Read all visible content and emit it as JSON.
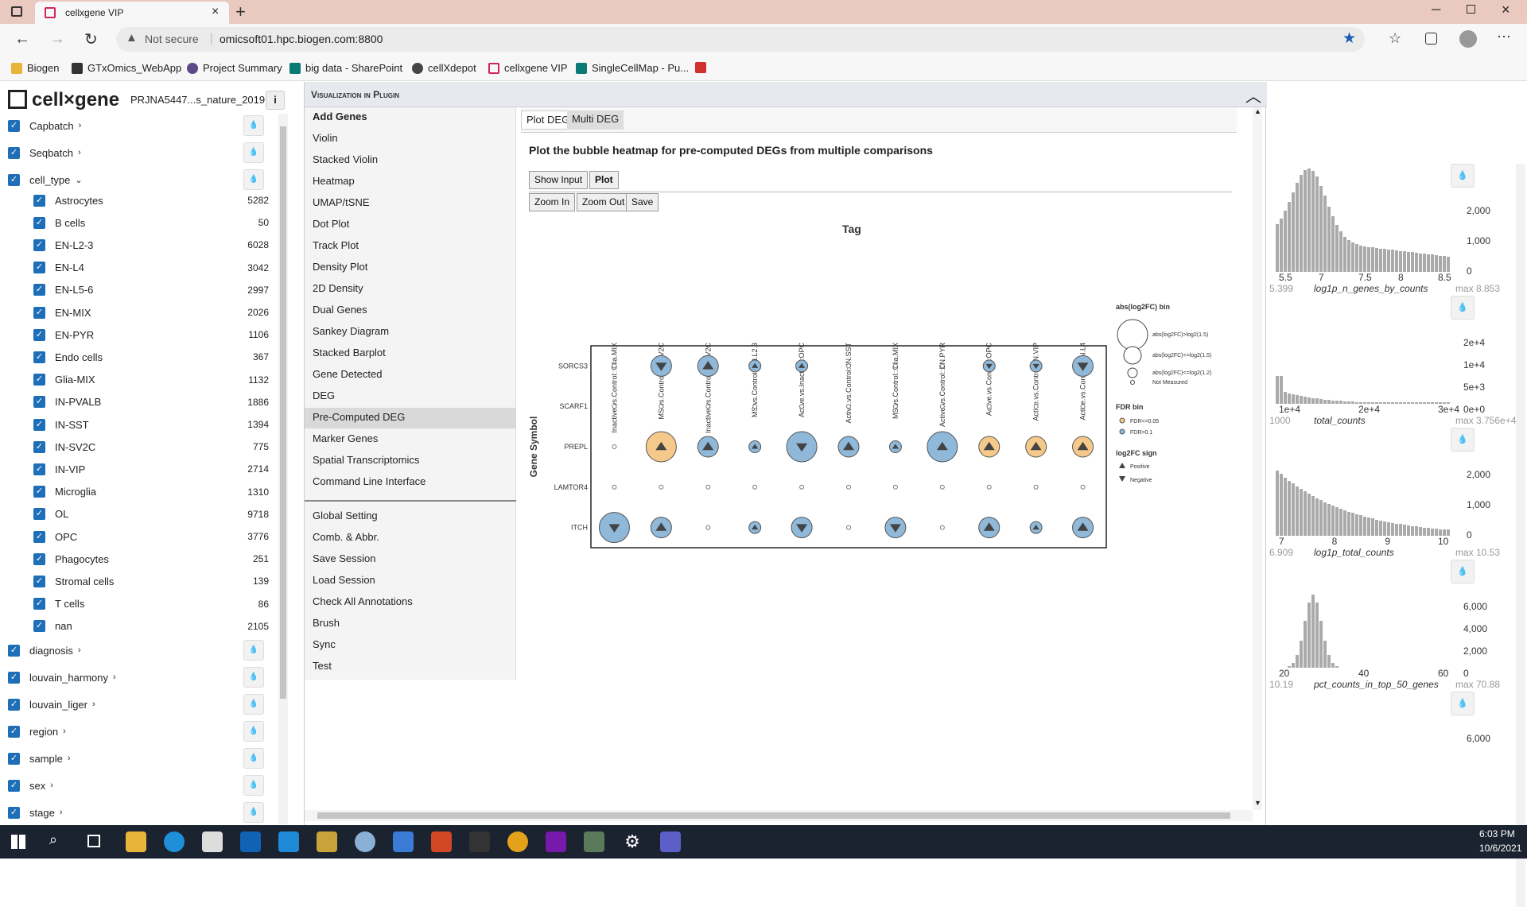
{
  "browser": {
    "tab_title": "cellxgene VIP",
    "security": "Not secure",
    "url": "omicsoft01.hpc.biogen.com:8800",
    "bookmarks": [
      "Biogen",
      "GTxOmics_WebApp",
      "Project Summary",
      "big data - SharePoint",
      "cellXdepot",
      "cellxgene VIP",
      "SingleCellMap - Pu..."
    ]
  },
  "app": {
    "logo": "cell×gene",
    "dataset": "PRJNA5447...s_nature_2019"
  },
  "sidebar": {
    "categories_top": [
      "Capbatch",
      "Seqbatch",
      "cell_type"
    ],
    "cell_types": [
      {
        "label": "Astrocytes",
        "count": "5282"
      },
      {
        "label": "B cells",
        "count": "50"
      },
      {
        "label": "EN-L2-3",
        "count": "6028"
      },
      {
        "label": "EN-L4",
        "count": "3042"
      },
      {
        "label": "EN-L5-6",
        "count": "2997"
      },
      {
        "label": "EN-MIX",
        "count": "2026"
      },
      {
        "label": "EN-PYR",
        "count": "1106"
      },
      {
        "label": "Endo cells",
        "count": "367"
      },
      {
        "label": "Glia-MIX",
        "count": "1132"
      },
      {
        "label": "IN-PVALB",
        "count": "1886"
      },
      {
        "label": "IN-SST",
        "count": "1394"
      },
      {
        "label": "IN-SV2C",
        "count": "775"
      },
      {
        "label": "IN-VIP",
        "count": "2714"
      },
      {
        "label": "Microglia",
        "count": "1310"
      },
      {
        "label": "OL",
        "count": "9718"
      },
      {
        "label": "OPC",
        "count": "3776"
      },
      {
        "label": "Phagocytes",
        "count": "251"
      },
      {
        "label": "Stromal cells",
        "count": "139"
      },
      {
        "label": "T cells",
        "count": "86"
      },
      {
        "label": "nan",
        "count": "2105"
      }
    ],
    "categories_bottom": [
      "diagnosis",
      "louvain_harmony",
      "louvain_liger",
      "region",
      "sample",
      "sex",
      "stage"
    ]
  },
  "plugin": {
    "title": "Visualization in Plugin",
    "menu": [
      "Add Genes",
      "Violin",
      "Stacked Violin",
      "Heatmap",
      "UMAP/tSNE",
      "Dot Plot",
      "Track Plot",
      "Density Plot",
      "2D Density",
      "Dual Genes",
      "Sankey Diagram",
      "Stacked Barplot",
      "Gene Detected",
      "DEG",
      "Pre-Computed DEG",
      "Marker Genes",
      "Spatial Transcriptomics",
      "Command Line Interface"
    ],
    "menu2": [
      "Global Setting",
      "Comb. & Abbr.",
      "Save Session",
      "Load Session",
      "Check All Annotations",
      "Brush",
      "Sync",
      "Test"
    ],
    "tabs": [
      "Plot DEG",
      "Multi DEG"
    ],
    "heading": "Plot the bubble heatmap for pre-computed DEGs from multiple comparisons",
    "buttons": {
      "show_input": "Show Input",
      "plot": "Plot",
      "zoom_in": "Zoom In",
      "zoom_out": "Zoom Out",
      "save": "Save"
    }
  },
  "chart_data": {
    "type": "bubble-heatmap",
    "title": "Tag",
    "ylabel": "Gene Symbol",
    "tags": [
      "Inactive.vs.Control::Glia.MIX",
      "MS.vs.Control::IN.SV2C",
      "Inactive.vs.Control::IN.SV2C",
      "MS.vs.Control::EN.L2.3",
      "Active.vs.Inactive::OPC",
      "Active.vs.Control::IN.SST",
      "MS.vs.Control::Glia.MIX",
      "Active.vs.Control::EN.PYR",
      "Active.vs.Control::OPC",
      "Active.vs.Control::IN.VIP",
      "Active.vs.Control::EN.L4"
    ],
    "genes": [
      "SORCS3",
      "SCARF1",
      "PREPL",
      "LAMTOR4",
      "ITCH"
    ],
    "size_levels": [
      "NM",
      "S",
      "M",
      "L"
    ],
    "cells": [
      [
        "NM",
        "M:blue:neg",
        "M:blue:pos",
        "S:blue:pos",
        "S:blue:pos",
        "NM",
        "NM",
        "NM",
        "S:blue:neg",
        "S:blue:neg",
        "M:blue:neg"
      ],
      [
        "NM",
        "NM",
        "NM",
        "NM",
        "NM",
        "NM",
        "NM",
        "NM",
        "NM",
        "NM",
        "NM"
      ],
      [
        "NM",
        "L:orange:pos",
        "M:blue:pos",
        "S:blue:pos",
        "L:blue:neg",
        "M:blue:pos",
        "S:blue:pos",
        "L:blue:pos",
        "M:orange:pos",
        "M:orange:pos",
        "M:orange:pos"
      ],
      [
        "NM",
        "NM",
        "NM",
        "NM",
        "NM",
        "NM",
        "NM",
        "NM",
        "NM",
        "NM",
        "NM"
      ],
      [
        "L:blue:neg",
        "M:blue:pos",
        "NM",
        "S:blue:pos",
        "M:blue:neg",
        "NM",
        "M:blue:neg",
        "NM",
        "M:blue:pos",
        "S:blue:pos",
        "M:blue:pos"
      ]
    ],
    "colors": {
      "blue": "#8fb8d9",
      "orange": "#f5c98a"
    },
    "legend": {
      "size_title": "abs(log2FC) bin",
      "size_items": [
        "abs(log2FC)>log2(1.5)",
        "abs(log2FC)<=log2(1.5)",
        "abs(log2FC)<=log2(1.2)",
        "Not Measured"
      ],
      "fdr_title": "FDR bin",
      "fdr_items": [
        "FDR<=0.05",
        "FDR>0.1"
      ],
      "sign_title": "log2FC sign",
      "sign_items": [
        "Positive",
        "Negative"
      ]
    }
  },
  "histograms": [
    {
      "name": "log1p_n_genes_by_counts",
      "min": "5.399",
      "max": "max 8.853",
      "xticks": [
        "5.5",
        "7",
        "7.5",
        "8",
        "8.5"
      ],
      "yticks": [
        "2,000",
        "1,000",
        "0"
      ]
    },
    {
      "name": "total_counts",
      "min": "1000",
      "max": "max 3.756e+4",
      "xticks": [
        "1e+4",
        "2e+4",
        "3e+4"
      ],
      "yticks": [
        "2e+4",
        "1e+4",
        "5e+3",
        "0e+0"
      ]
    },
    {
      "name": "log1p_total_counts",
      "min": "6.909",
      "max": "max 10.53",
      "xticks": [
        "7",
        "8",
        "9",
        "10"
      ],
      "yticks": [
        "2,000",
        "1,000",
        "0"
      ]
    },
    {
      "name": "pct_counts_in_top_50_genes",
      "min": "10.19",
      "max": "max 70.88",
      "xticks": [
        "20",
        "40",
        "60"
      ],
      "yticks": [
        "6,000",
        "4,000",
        "2,000",
        "0"
      ]
    },
    {
      "name": "",
      "min": "",
      "max": "",
      "xticks": [],
      "yticks": [
        "6,000"
      ]
    }
  ],
  "taskbar": {
    "time": "6:03 PM",
    "date": "10/6/2021"
  }
}
